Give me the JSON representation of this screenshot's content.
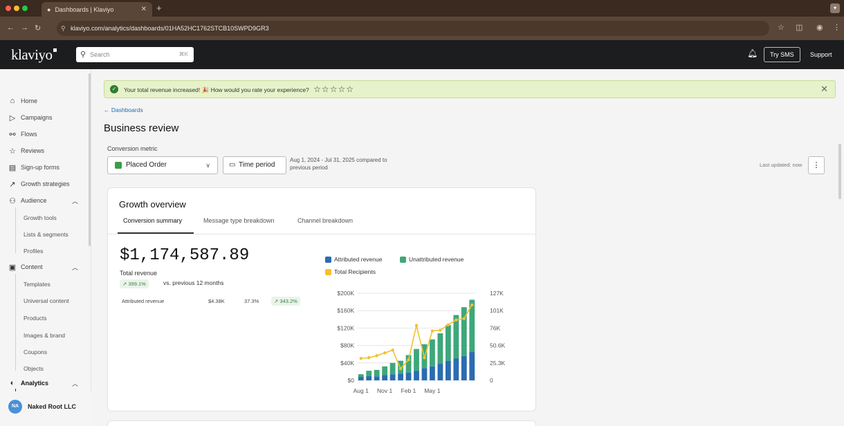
{
  "browser": {
    "tab_title": "Dashboards | Klaviyo",
    "url": "klaviyo.com/analytics/dashboards/01HA52HC1762STCB10SWPD9GR3"
  },
  "header": {
    "logo": "klaviyo",
    "search_placeholder": "Search",
    "search_shortcut": "⌘K",
    "try_sms": "Try SMS",
    "support": "Support"
  },
  "sidebar": {
    "items": [
      {
        "label": "Home",
        "icon": "home-icon"
      },
      {
        "label": "Campaigns",
        "icon": "campaigns-icon"
      },
      {
        "label": "Flows",
        "icon": "flows-icon"
      },
      {
        "label": "Reviews",
        "icon": "star-icon"
      },
      {
        "label": "Sign-up forms",
        "icon": "forms-icon"
      },
      {
        "label": "Growth strategies",
        "icon": "growth-icon"
      },
      {
        "label": "Audience",
        "icon": "audience-icon"
      },
      {
        "label": "Content",
        "icon": "content-icon"
      },
      {
        "label": "Analytics",
        "icon": "analytics-icon"
      }
    ],
    "audience_sub": [
      "Growth tools",
      "Lists & segments",
      "Profiles"
    ],
    "content_sub": [
      "Templates",
      "Universal content",
      "Products",
      "Images & brand",
      "Coupons",
      "Objects"
    ],
    "org_initials": "NA",
    "org_name": "Naked Root LLC"
  },
  "banner": {
    "text": "Your total revenue increased! 🎉 How would you rate your experience?",
    "stars": "☆☆☆☆☆"
  },
  "breadcrumb": "← Dashboards",
  "page_title": "Business review",
  "controls": {
    "conversion_metric_label": "Conversion metric",
    "metric": "Placed Order",
    "time_period": "Time period",
    "range_line1": "Aug 1, 2024 - Jul 31, 2025 compared to",
    "range_line2": "previous period",
    "last_updated": "Last updated: now"
  },
  "card": {
    "title": "Growth overview",
    "tabs": [
      "Conversion summary",
      "Message type breakdown",
      "Channel breakdown"
    ],
    "total_revenue": "$1,174,587.89",
    "total_revenue_label": "Total revenue",
    "change_pct": "399.1%",
    "change_suffix": "vs. previous 12 months",
    "attributed_label": "Attributed revenue",
    "attributed_value": "$4.38K",
    "attributed_share": "37.3%",
    "attributed_change": "343.2%"
  },
  "chart_data": {
    "type": "bar",
    "stacked": true,
    "legend": [
      "Attributed revenue",
      "Unattributed revenue",
      "Total Recipients"
    ],
    "colors": {
      "attributed": "#2b6cb0",
      "unattributed": "#3ea77a",
      "recipients": "#f2c12e"
    },
    "x_tick_labels": [
      "Aug 1",
      "Nov 1",
      "Feb 1",
      "May 1"
    ],
    "x_tick_index": [
      0,
      3,
      6,
      9
    ],
    "y_left_ticks": [
      "$200K",
      "$160K",
      "$120K",
      "$80K",
      "$40K",
      "$0"
    ],
    "y_left_max": 200000,
    "y_right_ticks": [
      "127K",
      "101K",
      "76K",
      "50.6K",
      "25.3K",
      "0"
    ],
    "y_right_max": 127000,
    "series": [
      {
        "name": "Attributed revenue",
        "values": [
          8000,
          10000,
          9000,
          12000,
          14000,
          15000,
          18000,
          22000,
          28000,
          32000,
          38000,
          45000,
          50000,
          56000,
          65000
        ]
      },
      {
        "name": "Unattributed revenue",
        "values": [
          6000,
          12000,
          15000,
          20000,
          26000,
          30000,
          40000,
          50000,
          55000,
          62000,
          70000,
          82000,
          100000,
          112000,
          120000
        ]
      },
      {
        "name": "Total Recipients",
        "values": [
          32000,
          33000,
          36000,
          40000,
          44000,
          17000,
          30000,
          80000,
          33000,
          72000,
          73000,
          81000,
          88000,
          90000,
          110000
        ]
      }
    ]
  }
}
